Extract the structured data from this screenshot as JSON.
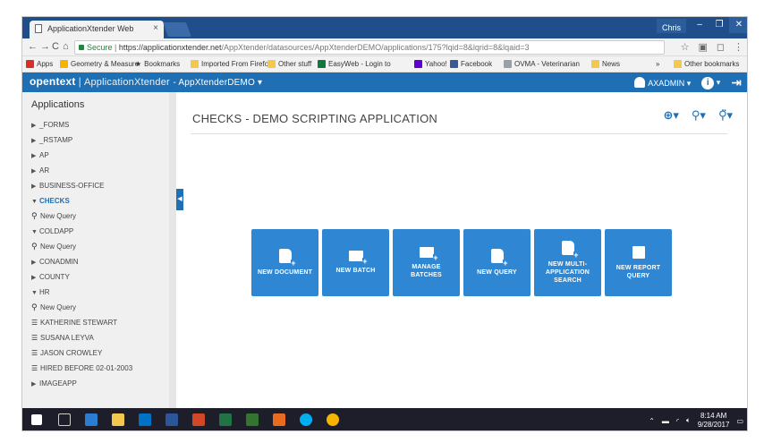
{
  "browser": {
    "tab_title": "ApplicationXtender Web",
    "user": "Chris",
    "url_secure": "Secure",
    "url_host": "https://applicationxtender.net",
    "url_path": "/AppXtender/datasources/AppXtenderDEMO/applications/175?lqid=8&lqrid=8&lqaid=3",
    "bookmarks": [
      "Apps",
      "Geometry & Measure",
      "Bookmarks",
      "Imported From Firefo",
      "Other stuff",
      "EasyWeb - Login to",
      "Yahoo!",
      "Facebook",
      "OVMA - Veterinarian",
      "News",
      "Other bookmarks"
    ],
    "bookmarks_more": "»"
  },
  "header": {
    "brand": "opentext",
    "product": "ApplicationXtender",
    "datasource": "AppXtenderDEMO",
    "user": "AXADMIN"
  },
  "sidebar": {
    "title": "Applications",
    "items": [
      {
        "label": "_FORMS",
        "type": "app"
      },
      {
        "label": "_RSTAMP",
        "type": "app"
      },
      {
        "label": "AP",
        "type": "app"
      },
      {
        "label": "AR",
        "type": "app"
      },
      {
        "label": "BUSINESS-OFFICE",
        "type": "app"
      },
      {
        "label": "CHECKS",
        "type": "app-open-active"
      },
      {
        "label": "New Query",
        "type": "query"
      },
      {
        "label": "COLDAPP",
        "type": "app-open"
      },
      {
        "label": "New Query",
        "type": "query"
      },
      {
        "label": "CONADMIN",
        "type": "app"
      },
      {
        "label": "COUNTY",
        "type": "app"
      },
      {
        "label": "HR",
        "type": "app-open"
      },
      {
        "label": "New Query",
        "type": "query"
      },
      {
        "label": "KATHERINE STEWART",
        "type": "saved"
      },
      {
        "label": "SUSANA LEYVA",
        "type": "saved"
      },
      {
        "label": "JASON CROWLEY",
        "type": "saved"
      },
      {
        "label": "HIRED BEFORE 02-01-2003",
        "type": "saved"
      },
      {
        "label": "IMAGEAPP",
        "type": "app"
      }
    ]
  },
  "main": {
    "title": "CHECKS - DEMO SCRIPTING APPLICATION",
    "tiles": [
      {
        "line1": "NEW DOCUMENT",
        "line2": "",
        "line3": "",
        "icon": "new-document-icon"
      },
      {
        "line1": "NEW BATCH",
        "line2": "",
        "line3": "",
        "icon": "new-batch-icon"
      },
      {
        "line1": "MANAGE BATCHES",
        "line2": "",
        "line3": "",
        "icon": "manage-batches-icon"
      },
      {
        "line1": "NEW QUERY",
        "line2": "",
        "line3": "",
        "icon": "new-query-icon"
      },
      {
        "line1": "NEW MULTI-",
        "line2": "APPLICATION",
        "line3": "SEARCH",
        "icon": "multi-app-search-icon"
      },
      {
        "line1": "NEW REPORT",
        "line2": "QUERY",
        "line3": "",
        "icon": "report-query-icon"
      }
    ]
  },
  "taskbar": {
    "time": "8:14 AM",
    "date": "9/28/2017"
  },
  "colors": {
    "accent": "#1f6fb5",
    "tile": "#2f87d4"
  }
}
